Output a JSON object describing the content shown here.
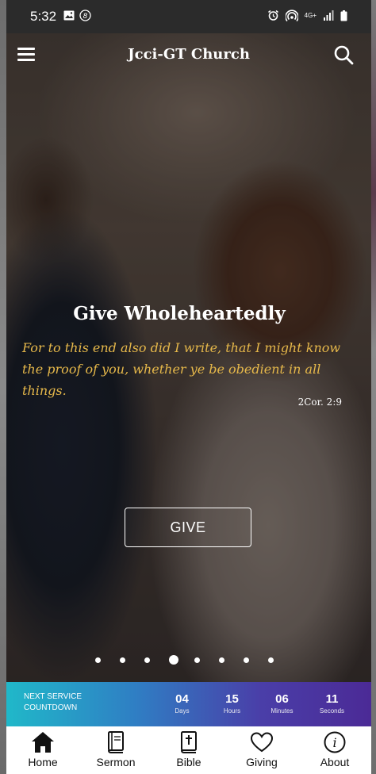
{
  "status_bar": {
    "time": "5:32",
    "left_icons": [
      "image-icon",
      "s-badge-icon"
    ],
    "right_icons": [
      "alarm-icon",
      "hotspot-icon",
      "signal-4g-icon",
      "battery-icon"
    ],
    "network": "4G+"
  },
  "header": {
    "title": "Jcci-GT Church",
    "menu_icon": "hamburger-menu-icon",
    "search_icon": "search-icon"
  },
  "slide": {
    "heading": "Give Wholeheartedly",
    "verse": "For to this end also did I write, that I might know the proof of you, whether ye be obedient in all things.",
    "reference": "2Cor. 2:9",
    "button_label": "GIVE",
    "verse_color": "#e6b84a",
    "slide_count": 8,
    "active_slide": 4
  },
  "countdown": {
    "label_line1": "NEXT SERVICE",
    "label_line2": "COUNTDOWN",
    "units": [
      {
        "value": "04",
        "label": "Days"
      },
      {
        "value": "15",
        "label": "Hours"
      },
      {
        "value": "06",
        "label": "Minutes"
      },
      {
        "value": "11",
        "label": "Seconds"
      }
    ],
    "gradient_start": "#20b8c9",
    "gradient_end": "#4b2a96"
  },
  "bottom_nav": {
    "items": [
      {
        "label": "Home",
        "icon": "home-icon"
      },
      {
        "label": "Sermon",
        "icon": "book-icon"
      },
      {
        "label": "Bible",
        "icon": "bible-icon"
      },
      {
        "label": "Giving",
        "icon": "heart-icon"
      },
      {
        "label": "About",
        "icon": "info-icon"
      }
    ]
  }
}
